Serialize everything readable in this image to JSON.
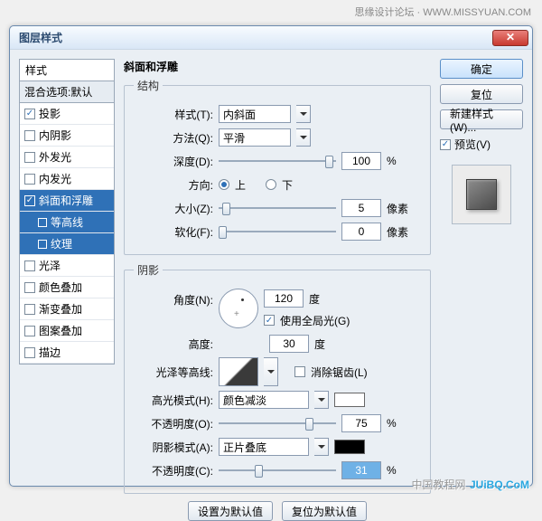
{
  "watermark": {
    "top": "思缘设计论坛 · WWW.MISSYUAN.COM",
    "bottom_cn": "中国教程网",
    "bottom": "JUiBQ.CoM"
  },
  "dialog": {
    "title": "图层样式"
  },
  "left": {
    "header": "样式",
    "blend": "混合选项:默认",
    "items": [
      {
        "label": "投影",
        "checked": true
      },
      {
        "label": "内阴影",
        "checked": false
      },
      {
        "label": "外发光",
        "checked": false
      },
      {
        "label": "内发光",
        "checked": false
      },
      {
        "label": "斜面和浮雕",
        "checked": true,
        "selected": true
      },
      {
        "label": "等高线",
        "sub": true,
        "selected": true
      },
      {
        "label": "纹理",
        "sub": true,
        "selected": true
      },
      {
        "label": "光泽",
        "checked": false
      },
      {
        "label": "颜色叠加",
        "checked": false
      },
      {
        "label": "渐变叠加",
        "checked": false
      },
      {
        "label": "图案叠加",
        "checked": false
      },
      {
        "label": "描边",
        "checked": false
      }
    ]
  },
  "mid": {
    "title": "斜面和浮雕",
    "structure": {
      "legend": "结构",
      "style_lbl": "样式(T):",
      "style_val": "内斜面",
      "tech_lbl": "方法(Q):",
      "tech_val": "平滑",
      "depth_lbl": "深度(D):",
      "depth_val": "100",
      "pct": "%",
      "dir_lbl": "方向:",
      "up": "上",
      "down": "下",
      "size_lbl": "大小(Z):",
      "size_val": "5",
      "px": "像素",
      "soft_lbl": "软化(F):",
      "soft_val": "0"
    },
    "shadow": {
      "legend": "阴影",
      "angle_lbl": "角度(N):",
      "angle_val": "120",
      "deg": "度",
      "global": "使用全局光(G)",
      "alt_lbl": "高度:",
      "alt_val": "30",
      "gloss_lbl": "光泽等高线:",
      "anti": "消除锯齿(L)",
      "hmode_lbl": "高光模式(H):",
      "hmode_val": "颜色减淡",
      "opac1_lbl": "不透明度(O):",
      "opac1_val": "75",
      "smode_lbl": "阴影模式(A):",
      "smode_val": "正片叠底",
      "opac2_lbl": "不透明度(C):",
      "opac2_val": "31"
    },
    "btns": {
      "default": "设置为默认值",
      "reset": "复位为默认值"
    }
  },
  "right": {
    "ok": "确定",
    "cancel": "复位",
    "newstyle": "新建样式(W)...",
    "preview": "预览(V)"
  },
  "colors": {
    "hilite": "#ffffff",
    "shadow": "#000000"
  }
}
